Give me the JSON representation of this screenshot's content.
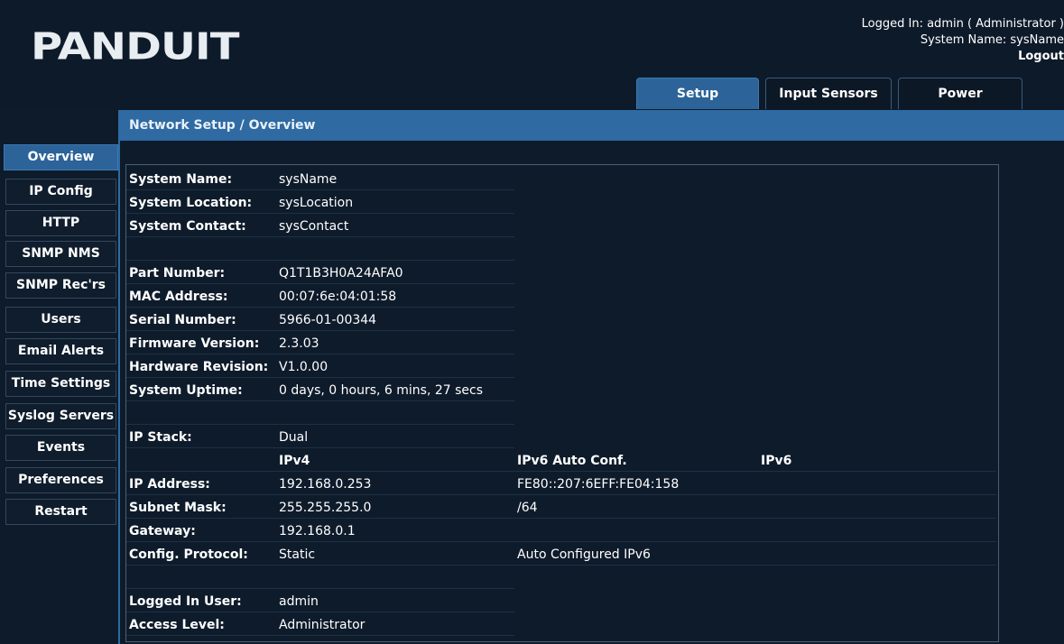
{
  "header": {
    "logo_text": "PANDUIT",
    "logged_in": "Logged In: admin ( Administrator )",
    "system_name": "System Name: sysName",
    "logout": "Logout",
    "tabs": [
      "Setup",
      "Input Sensors",
      "Power"
    ]
  },
  "nav": [
    "Overview",
    "IP Config",
    "HTTP",
    "SNMP NMS",
    "SNMP Rec'rs",
    "Users",
    "Email Alerts",
    "Time Settings",
    "Syslog Servers",
    "Events",
    "Preferences",
    "Restart"
  ],
  "panel": {
    "title": "Network Setup / Overview"
  },
  "rows": {
    "system_name": {
      "label": "System Name:",
      "value": "sysName"
    },
    "system_location": {
      "label": "System Location:",
      "value": "sysLocation"
    },
    "system_contact": {
      "label": "System Contact:",
      "value": "sysContact"
    },
    "part_number": {
      "label": "Part Number:",
      "value": "Q1T1B3H0A24AFA0"
    },
    "mac_address": {
      "label": "MAC Address:",
      "value": "00:07:6e:04:01:58"
    },
    "serial_number": {
      "label": "Serial Number:",
      "value": "5966-01-00344"
    },
    "firmware_version": {
      "label": "Firmware Version:",
      "value": "2.3.03"
    },
    "hardware_revision": {
      "label": "Hardware Revision:",
      "value": "V1.0.00"
    },
    "system_uptime": {
      "label": "System Uptime:",
      "value": "0 days, 0 hours, 6 mins, 27 secs"
    },
    "ip_stack": {
      "label": "IP Stack:",
      "value": "Dual"
    },
    "ip_headers": {
      "ipv4": "IPv4",
      "ipv6_auto": "IPv6 Auto Conf.",
      "ipv6": "IPv6"
    },
    "ip_address": {
      "label": "IP Address:",
      "ipv4": "192.168.0.253",
      "ipv6_auto": "FE80::207:6EFF:FE04:158",
      "ipv6": ""
    },
    "subnet_mask": {
      "label": "Subnet Mask:",
      "ipv4": "255.255.255.0",
      "ipv6_auto": "/64",
      "ipv6": ""
    },
    "gateway": {
      "label": "Gateway:",
      "ipv4": "192.168.0.1",
      "ipv6_auto": "",
      "ipv6": ""
    },
    "config_protocol": {
      "label": "Config. Protocol:",
      "ipv4": "Static",
      "ipv6_auto": "Auto Configured IPv6",
      "ipv6": ""
    },
    "logged_in_user": {
      "label": "Logged In User:",
      "value": "admin"
    },
    "access_level": {
      "label": "Access Level:",
      "value": "Administrator"
    }
  },
  "colors": {
    "background": "#0e1b2b",
    "accent": "#2f6aa2",
    "active_tab": "#2c6399"
  }
}
